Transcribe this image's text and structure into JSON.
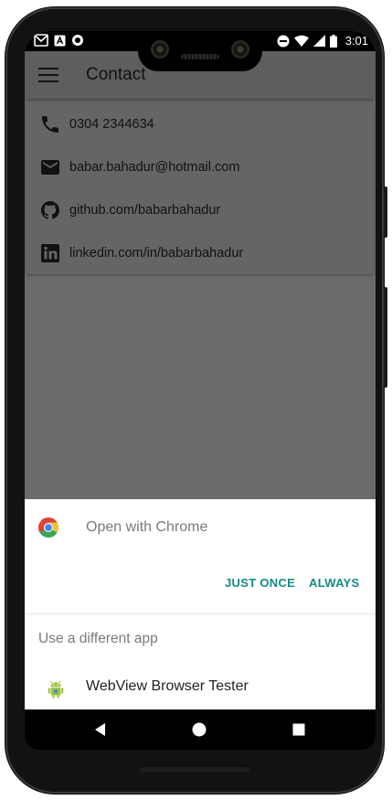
{
  "status_bar": {
    "time": "3:01",
    "left_icons": [
      "gmail-icon",
      "accessibility-notification-icon",
      "record-icon"
    ],
    "right_icons": [
      "do-not-disturb-icon",
      "wifi-icon",
      "signal-icon",
      "battery-icon"
    ]
  },
  "app_bar": {
    "title": "Contact",
    "menu_icon": "hamburger-menu-icon"
  },
  "contacts": [
    {
      "icon": "phone-icon",
      "text": "0304 2344634"
    },
    {
      "icon": "email-icon",
      "text": "babar.bahadur@hotmail.com"
    },
    {
      "icon": "github-icon",
      "text": "github.com/babarbahadur"
    },
    {
      "icon": "linkedin-icon",
      "text": "linkedin.com/in/babarbahadur"
    }
  ],
  "chooser": {
    "open_with": "Open with Chrome",
    "just_once": "JUST ONCE",
    "always": "ALWAYS",
    "different_app": "Use a different app",
    "apps": [
      {
        "icon": "android-icon",
        "name": "WebView Browser Tester"
      }
    ],
    "accent_color": "#138a82"
  },
  "nav_bar": {
    "buttons": [
      "back-icon",
      "home-icon",
      "recents-icon"
    ]
  }
}
